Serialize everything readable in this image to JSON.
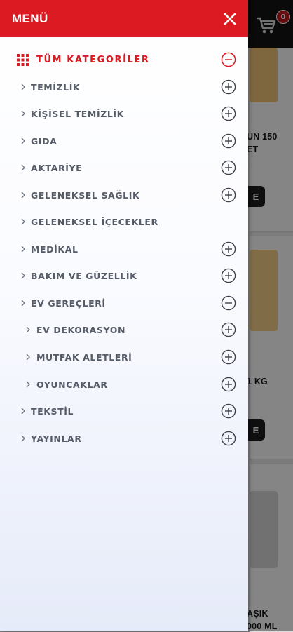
{
  "menu": {
    "title": "MENÜ",
    "all_categories_label": "TÜM KATEGORİLER",
    "items": [
      {
        "label": "TEMİZLİK",
        "toggle": "plus"
      },
      {
        "label": "KİŞİSEL TEMİZLİK",
        "toggle": "plus"
      },
      {
        "label": "GIDA",
        "toggle": "plus"
      },
      {
        "label": "AKTARİYE",
        "toggle": "plus"
      },
      {
        "label": "GELENEKSEL SAĞLIK",
        "toggle": "plus"
      },
      {
        "label": "GELENEKSEL İÇECEKLER",
        "toggle": "none"
      },
      {
        "label": "MEDİKAL",
        "toggle": "plus"
      },
      {
        "label": "BAKIM VE GÜZELLİK",
        "toggle": "plus"
      },
      {
        "label": "EV GEREÇLERİ",
        "toggle": "minus"
      },
      {
        "label": "EV DEKORASYON",
        "toggle": "plus"
      },
      {
        "label": "MUTFAK ALETLERİ",
        "toggle": "plus"
      },
      {
        "label": "OYUNCAKLAR",
        "toggle": "plus"
      },
      {
        "label": "TEKSTİL",
        "toggle": "plus"
      },
      {
        "label": "YAYINLAR",
        "toggle": "plus"
      }
    ]
  },
  "background": {
    "cart_count": "0",
    "product_texts": [
      "UN 150",
      "ET",
      "1 KG",
      "AŞIK",
      "000 ML"
    ],
    "button_fragment": "E"
  },
  "colors": {
    "accent": "#dc1a22",
    "item_text": "#555c68",
    "header_dark": "#151515"
  },
  "icons": {
    "close": "close-icon",
    "grid": "grid-icon",
    "expand": "plus-circle-icon",
    "collapse": "minus-circle-icon",
    "chevron": "chevron-right-icon",
    "cart": "cart-icon"
  }
}
